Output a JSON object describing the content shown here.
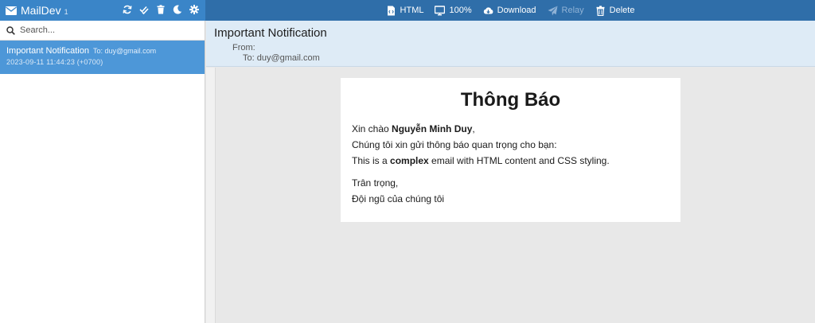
{
  "app": {
    "name": "MailDev",
    "count": "1"
  },
  "toolbar": {
    "html_label": "HTML",
    "zoom_label": "100%",
    "download_label": "Download",
    "relay_label": "Relay",
    "delete_label": "Delete"
  },
  "search": {
    "placeholder": "Search..."
  },
  "mail_list": [
    {
      "subject": "Important Notification",
      "to": "To: duy@gmail.com",
      "date": "2023-09-11 11:44:23 (+0700)"
    }
  ],
  "message": {
    "subject": "Important Notification",
    "from_label": "From:",
    "to_label": "To: duy@gmail.com"
  },
  "email": {
    "title": "Thông Báo",
    "greeting_prefix": "Xin chào ",
    "greeting_name": "Nguyễn Minh Duy",
    "greeting_suffix": ",",
    "intro": "Chúng tôi xin gửi thông báo quan trọng cho bạn:",
    "body_prefix": "This is a ",
    "body_bold": "complex",
    "body_suffix": " email with HTML content and CSS styling.",
    "signoff": "Trân trọng,",
    "signature": "Đội ngũ của chúng tôi"
  },
  "colors": {
    "brand_bar": "#3a85c8",
    "toolbar": "#2f6ea9",
    "selected_item": "#4d97d8",
    "header_bg": "#deebf6"
  }
}
